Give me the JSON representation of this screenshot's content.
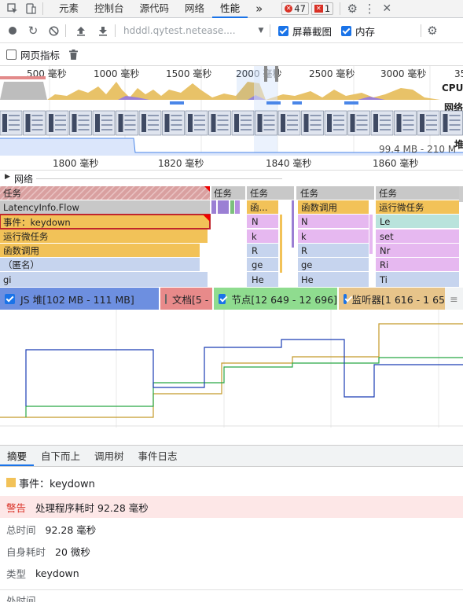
{
  "tabs": {
    "items": [
      "元素",
      "控制台",
      "源代码",
      "网络",
      "性能"
    ],
    "more": "»",
    "errors": "47",
    "warnings": "1"
  },
  "toolbar": {
    "url": "hdddl.qytest.netease....",
    "screenshots": "屏幕截图",
    "memory": "内存",
    "web_vitals": "网页指标"
  },
  "overview": {
    "ticks": [
      "500 毫秒",
      "1000 毫秒",
      "1500 毫秒",
      "2000 毫秒",
      "2500 毫秒",
      "3000 毫秒",
      "35"
    ],
    "cpu_label": "CPU",
    "net_label": "网络",
    "heap_label": "堆",
    "heap_range": "99.4 MB - 210 M"
  },
  "ruler": {
    "ticks": [
      "1800 毫秒",
      "1820 毫秒",
      "1840 毫秒",
      "1860 毫秒"
    ]
  },
  "network_label": "网络",
  "flame": {
    "task": "任务",
    "latency": "LatencyInfo.Flow",
    "event": "事件：keydown",
    "microtask": "运行微任务",
    "funcall": "函数调用",
    "anon": "（匿名）",
    "gi": "gi",
    "fn_short": "函...",
    "n": "N",
    "k": "k",
    "r": "R",
    "ge": "ge",
    "he": "He",
    "le": "Le",
    "set": "set",
    "nr": "Nr",
    "ri": "Ri",
    "ti": "Ti"
  },
  "counters": {
    "js_heap": "JS 堆[102 MB - 111 MB]",
    "documents": "文档[5 - 6]",
    "nodes": "节点[12 649 - 12 696]",
    "listeners": "监听器[1 616 - 1 65"
  },
  "bottom_tabs": [
    "摘要",
    "自下而上",
    "调用树",
    "事件日志"
  ],
  "summary": {
    "title": "事件：keydown",
    "warning_key": "警告",
    "warning_val": "处理程序耗时 92.28 毫秒",
    "total_key": "总时间",
    "total_val": "92.28 毫秒",
    "self_key": "自身耗时",
    "self_val": "20 微秒",
    "type_key": "类型",
    "type_val": "keydown",
    "cut_text": "处时间"
  },
  "colors": {
    "scripting": "#f2c258",
    "heap": "#1a3cb3",
    "nodes": "#28a745",
    "listeners": "#c49a2a",
    "accent": "#1a73e8"
  }
}
